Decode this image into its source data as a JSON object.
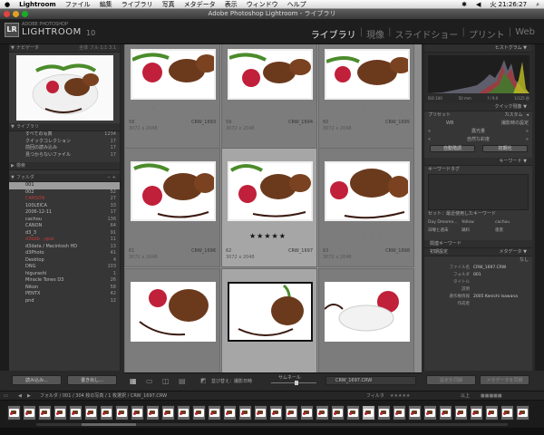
{
  "menubar": {
    "apple": "",
    "app": "Lightroom",
    "items": [
      "ファイル",
      "編集",
      "ライブラリ",
      "写真",
      "メタデータ",
      "表示",
      "ウィンドウ",
      "ヘルプ"
    ],
    "clock": "火 21:26:27"
  },
  "window": {
    "title": "Adobe Photoshop Lightroom - ライブラリ"
  },
  "brand": {
    "logo": "LR",
    "small": "ADOBE PHOTOSHOP",
    "big": "LIGHTROOM",
    "version": "10"
  },
  "modules": [
    "ライブラリ",
    "現像",
    "スライドショー",
    "プリント",
    "Web"
  ],
  "navigator": {
    "title": "ナビゲータ",
    "modes": [
      "全体",
      "フル",
      "1:1",
      "3:1"
    ]
  },
  "library": {
    "title": "ライブラリ",
    "items": [
      {
        "label": "すべての写真",
        "count": "1234"
      },
      {
        "label": "クイックコレクション",
        "count": "17"
      },
      {
        "label": "前回の読み込み",
        "count": "17"
      },
      {
        "label": "見つからないファイル",
        "count": "17"
      }
    ]
  },
  "keyword_list": {
    "title": "検索"
  },
  "folders": {
    "title": "フォルダ",
    "items": [
      {
        "label": "001",
        "count": "304"
      },
      {
        "label": "002",
        "count": "52"
      },
      {
        "label": "CARSON",
        "count": "27"
      },
      {
        "label": "100LEICA",
        "count": "33"
      },
      {
        "label": "2006-12-11",
        "count": "17"
      },
      {
        "label": "cachou",
        "count": "136"
      },
      {
        "label": "CANON",
        "count": "64"
      },
      {
        "label": "d3_3",
        "count": "91"
      },
      {
        "label": "d3bbb - ppai",
        "count": "11"
      },
      {
        "label": "d3data / Macintosh HD",
        "count": "13"
      },
      {
        "label": "d3Photo",
        "count": "41"
      },
      {
        "label": "Desktop",
        "count": "4"
      },
      {
        "label": "DNG",
        "count": "103"
      },
      {
        "label": "higurashi",
        "count": "1"
      },
      {
        "label": "Miracle Tones D3",
        "count": "26"
      },
      {
        "label": "Nikon",
        "count": "58"
      },
      {
        "label": "PENTX",
        "count": "42"
      },
      {
        "label": "pnd",
        "count": "12"
      }
    ]
  },
  "left_buttons": {
    "import": "読み込み...",
    "export": "書き出し..."
  },
  "grid": {
    "cells": [
      {
        "num": "58",
        "file": "CRW_1693",
        "dims": "3072 x 2048"
      },
      {
        "num": "59",
        "file": "CRW_1694",
        "dims": "3072 x 2048"
      },
      {
        "num": "60",
        "file": "CRW_1695",
        "dims": "3072 x 2048"
      },
      {
        "num": "61",
        "file": "CRW_1696",
        "dims": "3072 x 2048"
      },
      {
        "num": "62",
        "file": "CRW_1697",
        "dims": "3072 x 2048"
      },
      {
        "num": "63",
        "file": "CRW_1698",
        "dims": "3072 x 2048"
      },
      {
        "num": "",
        "file": "",
        "dims": ""
      },
      {
        "num": "",
        "file": "",
        "dims": ""
      },
      {
        "num": "",
        "file": "",
        "dims": ""
      }
    ],
    "stars": "★★★★★"
  },
  "toolbar": {
    "sort_label": "並び替え：撮影日時",
    "thumb_label": "サムネール",
    "filename": "CRW_1697.CRW"
  },
  "histogram": {
    "title": "ヒストグラム",
    "iso": "ISO 100",
    "focal": "50 mm",
    "aperture": "f / 9.0",
    "shutter": "1/125 秒"
  },
  "quick_develop": {
    "title": "クイック現像",
    "preset_label": "プリセット",
    "preset_value": "カスタム",
    "wb_label": "WB",
    "wb_value": "撮影時の設定",
    "tone_label": "階調",
    "exposure": "露光量",
    "clarity": "自然な彩度",
    "auto_tone": "自動階調",
    "reset": "初期化"
  },
  "keywords": {
    "title": "キーワード",
    "tag_label": "キーワードタグ",
    "set_label": "セット：最近使用したキーワード",
    "words": [
      "Day Dreame...",
      "Yellow",
      "cachou",
      "日曜と週末",
      "鍋料",
      "夜景"
    ]
  },
  "metadata": {
    "title": "メタデータ",
    "kw_title": "関連キーワード",
    "preset_label": "初期設定",
    "preset_value": "なし",
    "fields": [
      {
        "label": "ファイル名",
        "value": "CRW_1697.CRW"
      },
      {
        "label": "フォルダ",
        "value": "001"
      },
      {
        "label": "タイトル",
        "value": ""
      },
      {
        "label": "説明",
        "value": ""
      },
      {
        "label": "著作権情報",
        "value": "2005 Kenichi Isawana"
      },
      {
        "label": "作成者",
        "value": ""
      }
    ]
  },
  "right_buttons": {
    "sync_settings": "設定を同期",
    "sync_meta": "メタデータを同期"
  },
  "filmstrip_bar": {
    "path": "フォルダ / 001 / 304 枚の写真 / 1 枚選択 / CRW_1697.CRW",
    "filter_label": "フィルタ",
    "filter_value": "以上"
  }
}
